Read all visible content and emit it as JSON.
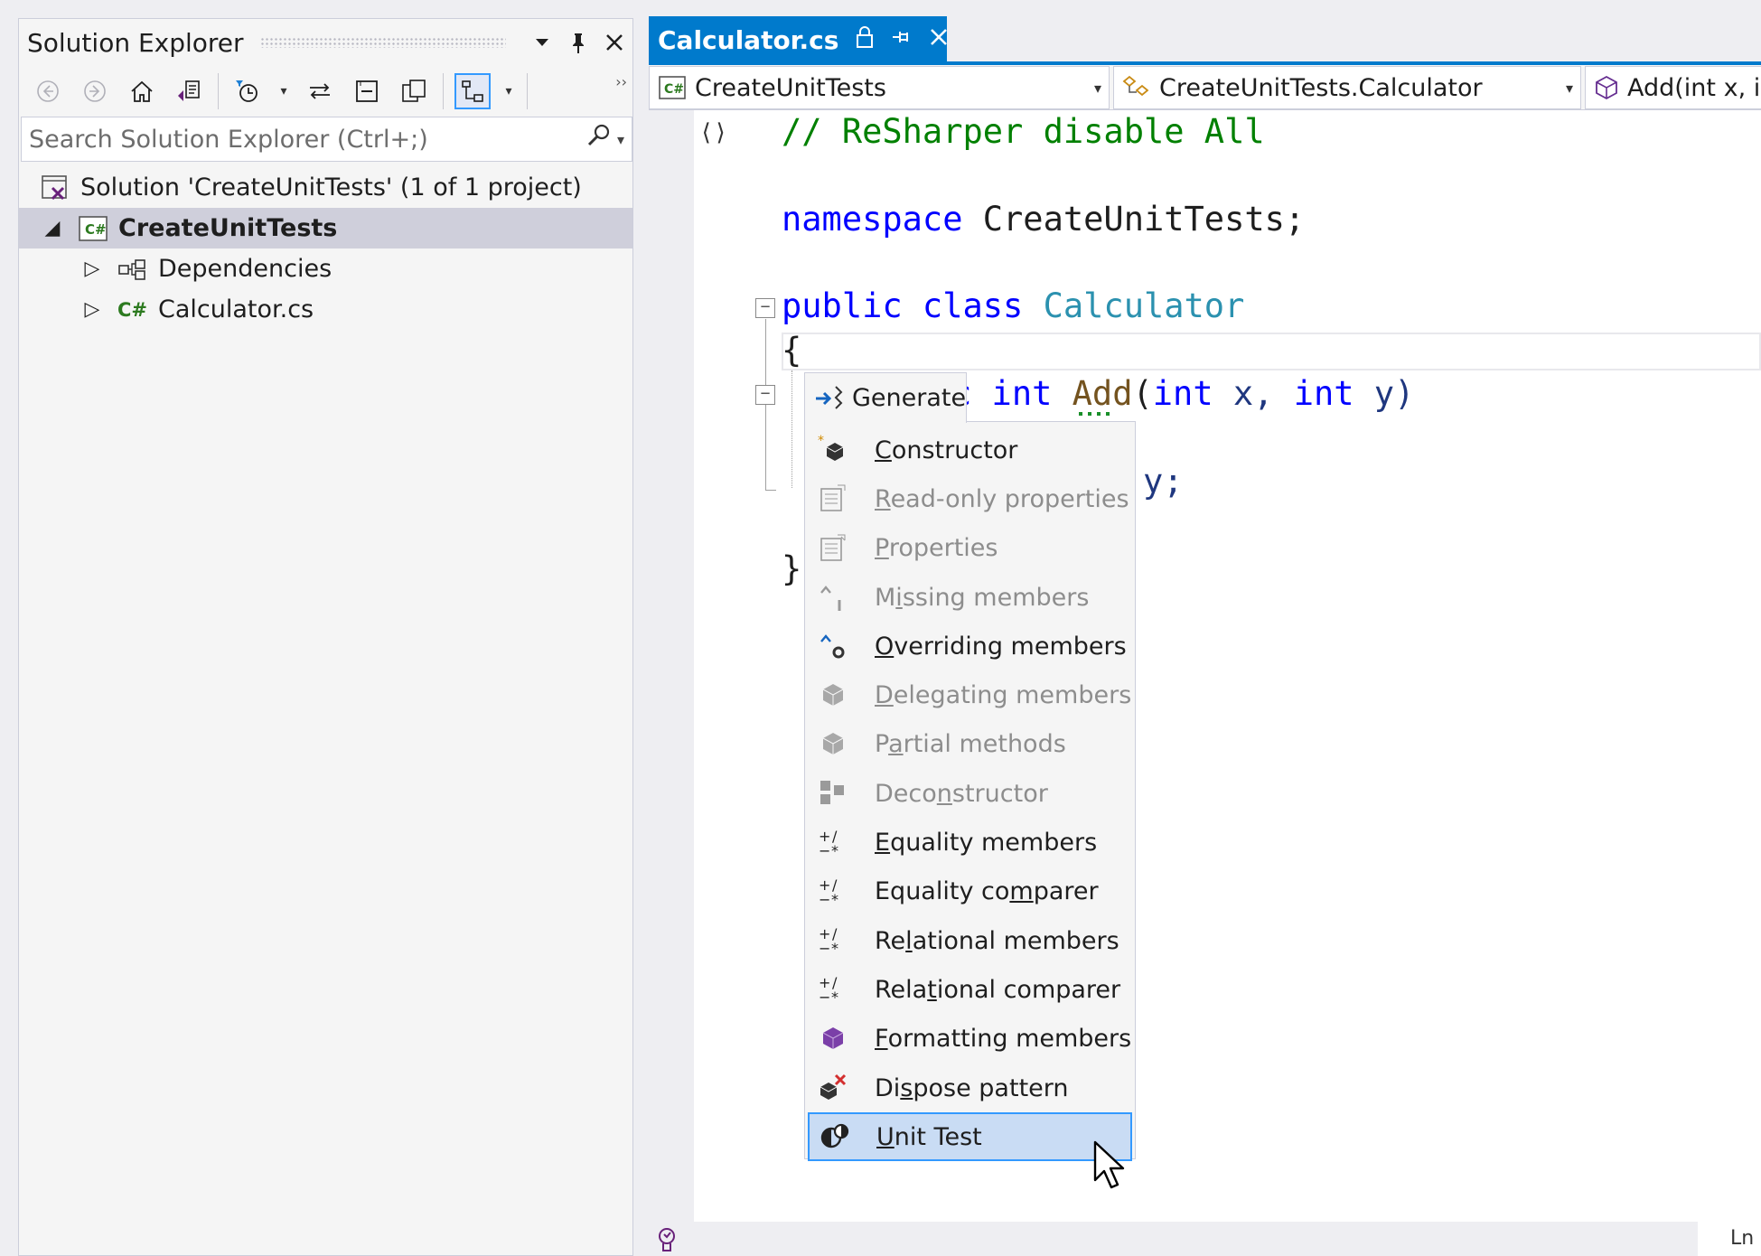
{
  "solution_explorer": {
    "title": "Solution Explorer",
    "search_placeholder": "Search Solution Explorer (Ctrl+;)",
    "solution_label": "Solution 'CreateUnitTests' (1 of 1 project)",
    "project_label": "CreateUnitTests",
    "dependencies_label": "Dependencies",
    "file_label": "Calculator.cs"
  },
  "editor": {
    "tab_title": "Calculator.cs",
    "nav": {
      "project": "CreateUnitTests",
      "class": "CreateUnitTests.Calculator",
      "member": "Add(int x, int y)"
    },
    "code": {
      "comment": "// ReSharper disable All",
      "ns_kw": "namespace",
      "ns_name": " CreateUnitTests;",
      "class_kw": "public class ",
      "class_name": "Calculator",
      "open_brace": "{",
      "method_kw": "c int ",
      "method_name": "Add",
      "method_params_a": "(",
      "method_params_b": "int",
      "method_params_c": " x, ",
      "method_params_d": "int",
      "method_params_e": " y)",
      "return_tail": "y;",
      "close_brace": "}"
    },
    "status_ln": "Ln"
  },
  "generate_menu": {
    "header": "Generate",
    "items": [
      {
        "pre": "",
        "u": "C",
        "post": "onstructor",
        "disabled": false,
        "icon": "constructor-icon"
      },
      {
        "pre": "",
        "u": "R",
        "post": "ead-only properties",
        "disabled": true,
        "icon": "readonly-properties-icon"
      },
      {
        "pre": "",
        "u": "P",
        "post": "roperties",
        "disabled": true,
        "icon": "properties-icon"
      },
      {
        "pre": "M",
        "u": "i",
        "post": "ssing members",
        "disabled": true,
        "icon": "missing-members-icon"
      },
      {
        "pre": "",
        "u": "O",
        "post": "verriding members",
        "disabled": false,
        "icon": "overriding-members-icon"
      },
      {
        "pre": "",
        "u": "D",
        "post": "elegating members",
        "disabled": true,
        "icon": "delegating-members-icon"
      },
      {
        "pre": "P",
        "u": "a",
        "post": "rtial methods",
        "disabled": true,
        "icon": "partial-methods-icon"
      },
      {
        "pre": "Deco",
        "u": "n",
        "post": "structor",
        "disabled": true,
        "icon": "deconstructor-icon"
      },
      {
        "pre": "",
        "u": "E",
        "post": "quality members",
        "disabled": false,
        "icon": "equality-members-icon"
      },
      {
        "pre": "Equality co",
        "u": "m",
        "post": "parer",
        "disabled": false,
        "icon": "equality-comparer-icon"
      },
      {
        "pre": "Re",
        "u": "l",
        "post": "ational members",
        "disabled": false,
        "icon": "relational-members-icon"
      },
      {
        "pre": "Rela",
        "u": "t",
        "post": "ional comparer",
        "disabled": false,
        "icon": "relational-comparer-icon"
      },
      {
        "pre": "",
        "u": "F",
        "post": "ormatting members",
        "disabled": false,
        "icon": "formatting-members-icon"
      },
      {
        "pre": "Di",
        "u": "s",
        "post": "pose pattern",
        "disabled": false,
        "icon": "dispose-pattern-icon"
      },
      {
        "pre": "",
        "u": "U",
        "post": "nit Test",
        "disabled": false,
        "icon": "unit-test-icon",
        "selected": true
      }
    ]
  },
  "colors": {
    "accent": "#007acc",
    "keyword": "#0000ff",
    "comment": "#008000",
    "type": "#2b91af",
    "method": "#74531f",
    "selection": "#c9dcf4"
  }
}
